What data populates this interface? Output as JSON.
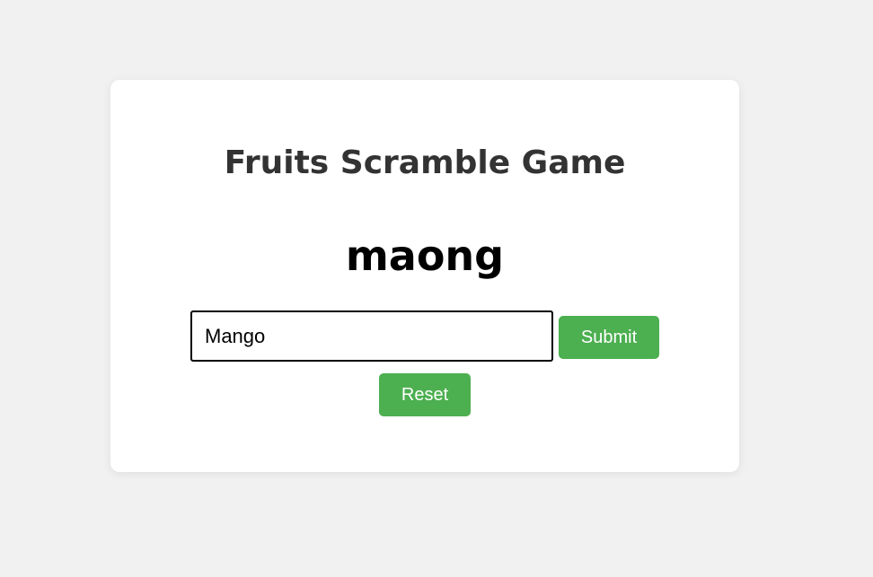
{
  "game": {
    "title": "Fruits Scramble Game",
    "scrambled_word": "maong",
    "guess_value": "Mango",
    "submit_label": "Submit",
    "reset_label": "Reset"
  },
  "colors": {
    "background": "#f1f1f1",
    "card": "#ffffff",
    "button": "#4caf50",
    "title": "#333333"
  }
}
